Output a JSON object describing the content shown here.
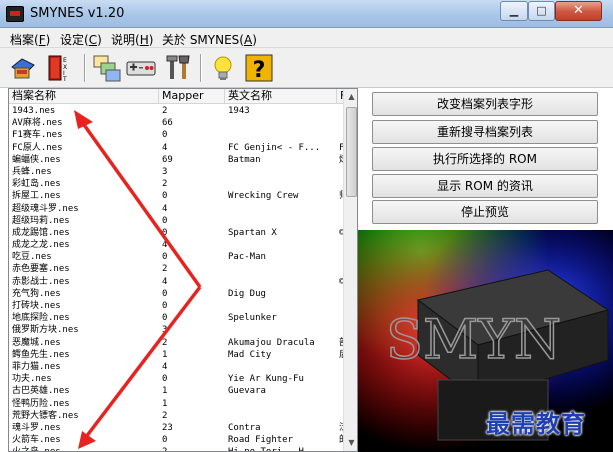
{
  "window": {
    "title": "SMYNES v1.20",
    "min_label": "▁",
    "max_label": "□",
    "close_label": "✕"
  },
  "menu": [
    {
      "label": "档案(",
      "key": "F",
      "tail": ")"
    },
    {
      "label": "设定(",
      "key": "C",
      "tail": ")"
    },
    {
      "label": "说明(",
      "key": "H",
      "tail": ")"
    },
    {
      "label": "关於 SMYNES(",
      "key": "A",
      "tail": ")"
    }
  ],
  "toolbar": {
    "icons": [
      "open-rom-icon",
      "exit-icon",
      "windows-icon",
      "controller-icon",
      "tools-icon",
      "lightbulb-icon",
      "help-icon"
    ],
    "exit_text": "EXIT",
    "help_text": "?"
  },
  "list": {
    "columns": [
      "档案名称",
      "Mapper",
      "英文名称",
      "F"
    ],
    "rows": [
      [
        "1943.nes",
        "2",
        "1943",
        ""
      ],
      [
        "AV麻将.nes",
        "66",
        "",
        ""
      ],
      [
        "F1赛车.nes",
        "0",
        "",
        ""
      ],
      [
        "FC原人.nes",
        "4",
        "FC Genjin< - F...",
        "F"
      ],
      [
        "蝙蝠侠.nes",
        "69",
        "Batman",
        "炼"
      ],
      [
        "兵蜂.nes",
        "3",
        "",
        ""
      ],
      [
        "彩虹岛.nes",
        "2",
        "",
        ""
      ],
      [
        "拆屋工.nes",
        "0",
        "Wrecking Crew",
        "师"
      ],
      [
        "超级魂斗罗.nes",
        "4",
        "",
        ""
      ],
      [
        "超级玛莉.nes",
        "0",
        "",
        ""
      ],
      [
        "成龙踢馆.nes",
        "0",
        "Spartan X",
        "©"
      ],
      [
        "成龙之龙.nes",
        "4",
        "",
        ""
      ],
      [
        "吃豆.nes",
        "0",
        "Pac-Man",
        ""
      ],
      [
        "赤色要塞.nes",
        "2",
        "",
        ""
      ],
      [
        "赤影战士.nes",
        "4",
        "",
        "©"
      ],
      [
        "充气狗.nes",
        "0",
        "Dig Dug",
        ""
      ],
      [
        "打砖块.nes",
        "0",
        "",
        ""
      ],
      [
        "地底探险.nes",
        "0",
        "Spelunker",
        ""
      ],
      [
        "俄罗斯方块.nes",
        "3",
        "",
        ""
      ],
      [
        "恶魔城.nes",
        "2",
        "Akumajou Dracula",
        "部"
      ],
      [
        "鳄鱼先生.nes",
        "1",
        "Mad City",
        "后"
      ],
      [
        "菲力猫.nes",
        "4",
        "",
        ""
      ],
      [
        "功夫.nes",
        "0",
        "Yie Ar Kung-Fu",
        ""
      ],
      [
        "古巴英雄.nes",
        "1",
        "Guevara",
        ""
      ],
      [
        "怪鸭历险.nes",
        "1",
        "",
        ""
      ],
      [
        "荒野大镖客.nes",
        "2",
        "",
        ""
      ],
      [
        "魂斗罗.nes",
        "23",
        "Contra",
        "泛"
      ],
      [
        "火箭车.nes",
        "0",
        "Road Fighter",
        "的"
      ],
      [
        "火之鸟.nes",
        "2",
        "Hi-no Tori - H...",
        ""
      ]
    ]
  },
  "actions": [
    "改变档案列表字形",
    "重新搜寻档案列表",
    "执行所选择的 ROM",
    "显示 ROM 的资讯",
    "停止预览"
  ],
  "preview": {
    "logo_text": "SMYN",
    "colors": {
      "red": "#ff2a2a",
      "green": "#1fd11f",
      "blue": "#2a4cff"
    }
  },
  "watermark": "最需教育",
  "colors": {
    "annotation_arrow": "#e8231f"
  }
}
